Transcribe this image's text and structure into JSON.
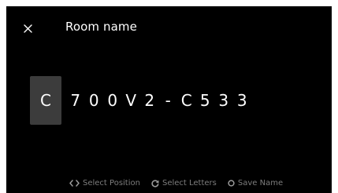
{
  "header": {
    "close_glyph": "×",
    "title": "Room name"
  },
  "name_editor": {
    "selected_index": 0,
    "characters": [
      "C",
      "7",
      "0",
      "0",
      "V",
      "2",
      "-",
      "C",
      "5",
      "3",
      "3"
    ]
  },
  "footer": {
    "hints": [
      {
        "icon": "left-right-arrows-icon",
        "label": "Select Position"
      },
      {
        "icon": "rotate-dial-icon",
        "label": "Select Letters"
      },
      {
        "icon": "circle-button-icon",
        "label": "Save Name"
      }
    ]
  }
}
